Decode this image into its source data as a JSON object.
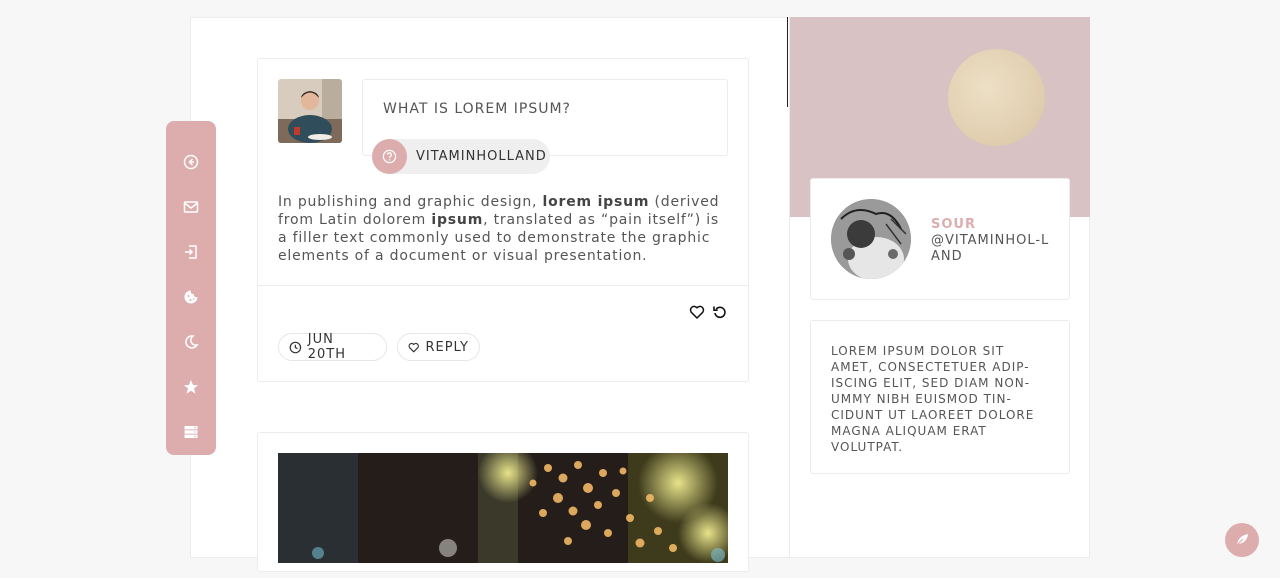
{
  "theme": {
    "accent": "#ddadae",
    "header_bg": "#d9c2c4"
  },
  "nav": {
    "items": [
      {
        "icon": "arrow-left-circle-icon"
      },
      {
        "icon": "envelope-icon"
      },
      {
        "icon": "sign-in-icon"
      },
      {
        "icon": "cookie-icon"
      },
      {
        "icon": "moon-icon"
      },
      {
        "icon": "star-icon"
      },
      {
        "icon": "database-icon"
      }
    ]
  },
  "post": {
    "question": "WHAT IS LOREM IPSUM?",
    "asker": "VITAMINHOLLAND",
    "body_parts": {
      "p1": "In publishing and graphic design, ",
      "b1": "lorem ipsum",
      "p2": " (derived from Latin dolorem ",
      "b2": "ipsum",
      "p3": ", translated as “pain itself”) is a filler text commonly used to demonstrate the graphic ele­ments of a document or visual presentation."
    },
    "date": "JUN 20TH",
    "reply_label": "REPLY"
  },
  "profile": {
    "name": "SOUR",
    "handle": "@VITAMINHOL-LAND"
  },
  "description": "LOREM IPSUM DOLOR SIT AMET, CONSECTETUER ADIP-ISCING ELIT, SED DIAM NON-UMMY NIBH EUISMOD TIN-CIDUNT UT LAOREET DOLORE MAGNA ALIQUAM ERAT VOLUTPAT."
}
